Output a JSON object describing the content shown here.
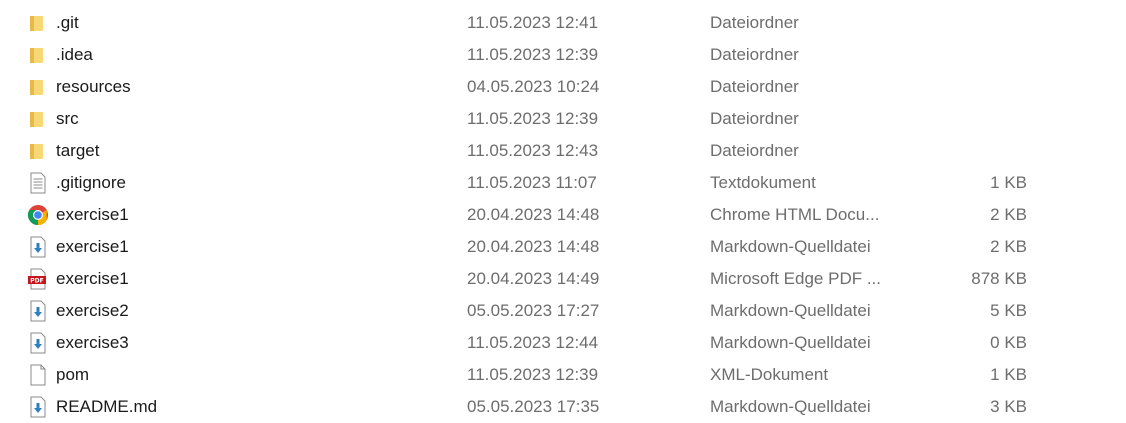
{
  "files": [
    {
      "name": ".git",
      "date": "11.05.2023 12:41",
      "type": "Dateiordner",
      "size": "",
      "icon": "folder-icon"
    },
    {
      "name": ".idea",
      "date": "11.05.2023 12:39",
      "type": "Dateiordner",
      "size": "",
      "icon": "folder-icon"
    },
    {
      "name": "resources",
      "date": "04.05.2023 10:24",
      "type": "Dateiordner",
      "size": "",
      "icon": "folder-icon"
    },
    {
      "name": "src",
      "date": "11.05.2023 12:39",
      "type": "Dateiordner",
      "size": "",
      "icon": "folder-icon"
    },
    {
      "name": "target",
      "date": "11.05.2023 12:43",
      "type": "Dateiordner",
      "size": "",
      "icon": "folder-icon"
    },
    {
      "name": ".gitignore",
      "date": "11.05.2023 11:07",
      "type": "Textdokument",
      "size": "1 KB",
      "icon": "text-document-icon"
    },
    {
      "name": "exercise1",
      "date": "20.04.2023 14:48",
      "type": "Chrome HTML Docu...",
      "size": "2 KB",
      "icon": "chrome-icon"
    },
    {
      "name": "exercise1",
      "date": "20.04.2023 14:48",
      "type": "Markdown-Quelldatei",
      "size": "2 KB",
      "icon": "markdown-file-icon"
    },
    {
      "name": "exercise1",
      "date": "20.04.2023 14:49",
      "type": "Microsoft Edge PDF ...",
      "size": "878 KB",
      "icon": "pdf-icon"
    },
    {
      "name": "exercise2",
      "date": "05.05.2023 17:27",
      "type": "Markdown-Quelldatei",
      "size": "5 KB",
      "icon": "markdown-file-icon"
    },
    {
      "name": "exercise3",
      "date": "11.05.2023 12:44",
      "type": "Markdown-Quelldatei",
      "size": "0 KB",
      "icon": "markdown-file-icon"
    },
    {
      "name": "pom",
      "date": "11.05.2023 12:39",
      "type": "XML-Dokument",
      "size": "1 KB",
      "icon": "blank-file-icon"
    },
    {
      "name": "README.md",
      "date": "05.05.2023 17:35",
      "type": "Markdown-Quelldatei",
      "size": "3 KB",
      "icon": "markdown-file-icon"
    }
  ],
  "colors": {
    "folder": "#f8d775",
    "folder_dark": "#e8b84a",
    "pdf_red": "#c4161c",
    "markdown_arrow": "#2f7fb8",
    "chrome_red": "#db4437",
    "chrome_yellow": "#f4b400",
    "chrome_green": "#0f9d58",
    "chrome_blue": "#4285f4",
    "secondary_text": "#6d6d6d"
  }
}
